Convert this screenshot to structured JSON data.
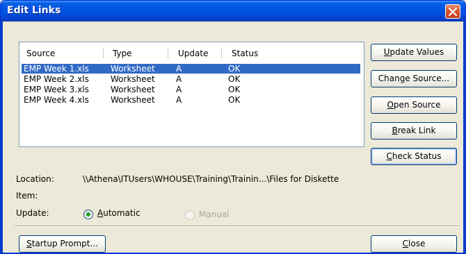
{
  "window": {
    "title": "Edit Links"
  },
  "links_list": {
    "columns": [
      "Source",
      "Type",
      "Update",
      "Status"
    ],
    "rows": [
      {
        "source": "EMP Week 1.xls",
        "type": "Worksheet",
        "update": "A",
        "status": "OK",
        "selected": true
      },
      {
        "source": "EMP Week 2.xls",
        "type": "Worksheet",
        "update": "A",
        "status": "OK",
        "selected": false
      },
      {
        "source": "EMP Week 3.xls",
        "type": "Worksheet",
        "update": "A",
        "status": "OK",
        "selected": false
      },
      {
        "source": "EMP Week 4.xls",
        "type": "Worksheet",
        "update": "A",
        "status": "OK",
        "selected": false
      }
    ]
  },
  "buttons": {
    "update_values": {
      "pre": "",
      "key": "U",
      "post": "pdate Values"
    },
    "change_source": {
      "pre": "Chan",
      "key": "g",
      "post": "e Source..."
    },
    "open_source": {
      "pre": "",
      "key": "O",
      "post": "pen Source"
    },
    "break_link": {
      "pre": "",
      "key": "B",
      "post": "reak Link"
    },
    "check_status": {
      "pre": "",
      "key": "C",
      "post": "heck Status"
    },
    "startup_prompt": {
      "pre": "",
      "key": "S",
      "post": "tartup Prompt..."
    },
    "close": {
      "pre": "",
      "key": "C",
      "post": "lose"
    }
  },
  "details": {
    "location_label": "Location:",
    "location_value": "\\\\Athena\\ITUsers\\WHOUSE\\Training\\Trainin...\\Files for Diskette",
    "item_label": "Item:",
    "update_label": "Update:",
    "automatic": {
      "pre": "",
      "key": "A",
      "post": "utomatic",
      "checked": true
    },
    "manual": {
      "label": "Manual",
      "enabled": false
    }
  },
  "colors": {
    "title_bar": "#0055E5",
    "selection": "#316AC5",
    "close_button": "#D8552E",
    "dialog_face": "#ECE9D8"
  },
  "icons": {
    "close": "close-x-icon",
    "radio_selected": "radio-checked-icon"
  }
}
